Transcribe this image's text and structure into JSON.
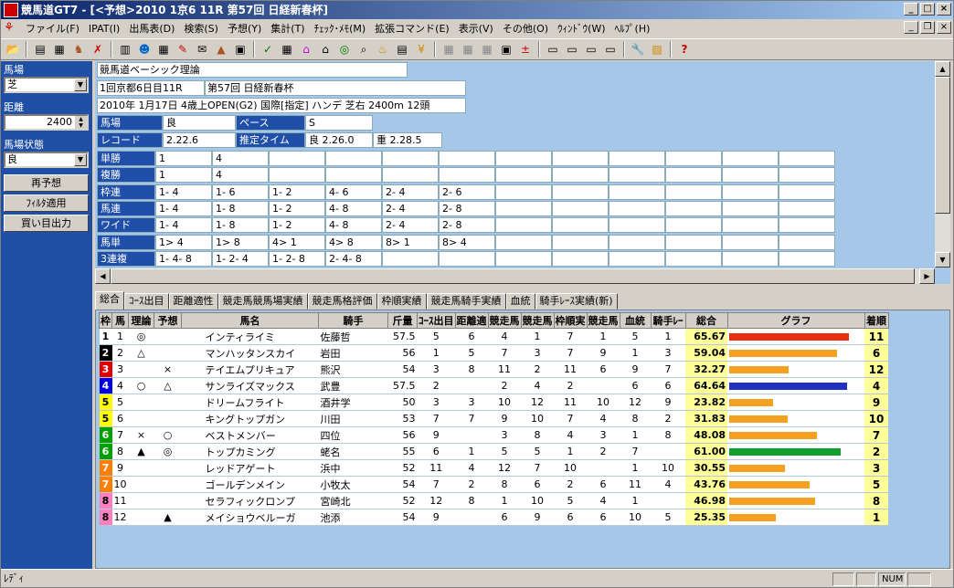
{
  "title": "競馬道GT7 - [<予想>2010 1京6 11R 第57回 日経新春杯]",
  "menu": [
    "ファイル(F)",
    "IPAT(I)",
    "出馬表(D)",
    "検索(S)",
    "予想(Y)",
    "集計(T)",
    "ﾁｪｯｸ･ﾒﾓ(M)",
    "拡張コマンド(E)",
    "表示(V)",
    "その他(O)",
    "ｳｨﾝﾄﾞｳ(W)",
    "ﾍﾙﾌﾟ(H)"
  ],
  "left": {
    "track_label": "馬場",
    "track_value": "芝",
    "distance_label": "距離",
    "distance_value": "2400",
    "condition_label": "馬場状態",
    "condition_value": "良",
    "btn_repredict": "再予想",
    "btn_filter": "ﾌｨﾙﾀ適用",
    "btn_output": "買い目出力"
  },
  "info": {
    "theory": "競馬道ベーシック理論",
    "race_day": "1回京都6日目11R",
    "race_name": "第57回 日経新春杯",
    "race_detail": "2010年 1月17日  4歳上OPEN(G2) 国際[指定] ハンデ 芝右 2400m 12頭",
    "baba_label": "馬場",
    "baba_value": "良",
    "pace_label": "ペース",
    "pace_value": "S",
    "record_label": "レコード",
    "record_value": "2.22.6",
    "est_label": "推定タイム",
    "est_good": "良 2.26.0",
    "est_heavy": "重 2.28.5"
  },
  "bets": [
    {
      "label": "単勝",
      "vals": [
        "1",
        "4"
      ]
    },
    {
      "label": "複勝",
      "vals": [
        "1",
        "4"
      ]
    },
    {
      "label": "枠連",
      "vals": [
        "1- 4",
        "1- 6",
        "1- 2",
        "4- 6",
        "2- 4",
        "2- 6"
      ]
    },
    {
      "label": "馬連",
      "vals": [
        "1- 4",
        "1- 8",
        "1- 2",
        "4- 8",
        "2- 4",
        "2- 8"
      ]
    },
    {
      "label": "ワイド",
      "vals": [
        "1- 4",
        "1- 8",
        "1- 2",
        "4- 8",
        "2- 4",
        "2- 8"
      ]
    },
    {
      "label": "馬単",
      "vals": [
        "1> 4",
        "1> 8",
        "4> 1",
        "4> 8",
        "8> 1",
        "8> 4"
      ]
    },
    {
      "label": "3連複",
      "vals": [
        "1- 4- 8",
        "1- 2- 4",
        "1- 2- 8",
        "2- 4- 8"
      ]
    }
  ],
  "tabs": [
    "総合",
    "ｺｰｽ出目",
    "距離適性",
    "競走馬競馬場実績",
    "競走馬格評価",
    "枠順実績",
    "競走馬騎手実績",
    "血統",
    "騎手ﾚｰｽ実績(新)"
  ],
  "columns": [
    "枠",
    "馬",
    "理論",
    "予想",
    "馬名",
    "騎手",
    "斤量",
    "ｺｰｽ出目",
    "距離適",
    "競走馬",
    "競走馬",
    "枠順実",
    "競走馬",
    "血統",
    "騎手ﾚｰ",
    "総合",
    "グラフ",
    "着順"
  ],
  "colors": {
    "waku1": "#ffffff",
    "waku2": "#000000",
    "waku3": "#e00000",
    "waku4": "#0000e0",
    "waku5": "#ffff00",
    "waku6": "#00a000",
    "waku7": "#ff8000",
    "waku8": "#ff80c0",
    "bar_red": "#e83010",
    "bar_orange": "#f4a020",
    "bar_blue": "#2030c0",
    "bar_green": "#10a030"
  },
  "rows": [
    {
      "waku": "1",
      "num": "1",
      "riron": "◎",
      "yoso": "",
      "name": "インティライミ",
      "jockey": "佐藤哲",
      "kinryo": "57.5",
      "c1": "5",
      "c2": "6",
      "c3": "4",
      "c4": "1",
      "c5": "7",
      "c6": "1",
      "c7": "5",
      "c8": "1",
      "total": "65.67",
      "score": 65.67,
      "bar": "bar_red",
      "rank": "11"
    },
    {
      "waku": "2",
      "num": "2",
      "riron": "△",
      "yoso": "",
      "name": "マンハッタンスカイ",
      "jockey": "岩田",
      "kinryo": "56",
      "c1": "1",
      "c2": "5",
      "c3": "7",
      "c4": "3",
      "c5": "7",
      "c6": "9",
      "c7": "1",
      "c8": "3",
      "total": "59.04",
      "score": 59.04,
      "bar": "bar_orange",
      "rank": "6"
    },
    {
      "waku": "3",
      "num": "3",
      "riron": "",
      "yoso": "×",
      "name": "テイエムプリキュア",
      "jockey": "熊沢",
      "kinryo": "54",
      "c1": "3",
      "c2": "8",
      "c3": "11",
      "c4": "2",
      "c5": "11",
      "c6": "6",
      "c7": "9",
      "c8": "7",
      "total": "32.27",
      "score": 32.27,
      "bar": "bar_orange",
      "rank": "12"
    },
    {
      "waku": "4",
      "num": "4",
      "riron": "○",
      "yoso": "△",
      "name": "サンライズマックス",
      "jockey": "武豊",
      "kinryo": "57.5",
      "c1": "2",
      "c2": "",
      "c3": "2",
      "c4": "4",
      "c5": "2",
      "c6": "",
      "c7": "6",
      "c8": "6",
      "total": "64.64",
      "score": 64.64,
      "bar": "bar_blue",
      "rank": "4"
    },
    {
      "waku": "5",
      "num": "5",
      "riron": "",
      "yoso": "",
      "name": "ドリームフライト",
      "jockey": "酒井学",
      "kinryo": "50",
      "c1": "3",
      "c2": "3",
      "c3": "10",
      "c4": "12",
      "c5": "11",
      "c6": "10",
      "c7": "12",
      "c8": "9",
      "total": "23.82",
      "score": 23.82,
      "bar": "bar_orange",
      "rank": "9"
    },
    {
      "waku": "5",
      "num": "6",
      "riron": "",
      "yoso": "",
      "name": "キングトップガン",
      "jockey": "川田",
      "kinryo": "53",
      "c1": "7",
      "c2": "7",
      "c3": "9",
      "c4": "10",
      "c5": "7",
      "c6": "4",
      "c7": "8",
      "c8": "2",
      "total": "31.83",
      "score": 31.83,
      "bar": "bar_orange",
      "rank": "10"
    },
    {
      "waku": "6",
      "num": "7",
      "riron": "×",
      "yoso": "○",
      "name": "ベストメンバー",
      "jockey": "四位",
      "kinryo": "56",
      "c1": "9",
      "c2": "",
      "c3": "3",
      "c4": "8",
      "c5": "4",
      "c6": "3",
      "c7": "1",
      "c8": "8",
      "total": "48.08",
      "score": 48.08,
      "bar": "bar_orange",
      "rank": "7"
    },
    {
      "waku": "6",
      "num": "8",
      "riron": "▲",
      "yoso": "◎",
      "name": "トップカミング",
      "jockey": "蛯名",
      "kinryo": "55",
      "c1": "6",
      "c2": "1",
      "c3": "5",
      "c4": "5",
      "c5": "1",
      "c6": "2",
      "c7": "7",
      "c8": "",
      "total": "61.00",
      "score": 61.0,
      "bar": "bar_green",
      "rank": "2"
    },
    {
      "waku": "7",
      "num": "9",
      "riron": "",
      "yoso": "",
      "name": "レッドアゲート",
      "jockey": "浜中",
      "kinryo": "52",
      "c1": "11",
      "c2": "4",
      "c3": "12",
      "c4": "7",
      "c5": "10",
      "c6": "",
      "c7": "1",
      "c8": "10",
      "total": "30.55",
      "score": 30.55,
      "bar": "bar_orange",
      "rank": "3"
    },
    {
      "waku": "7",
      "num": "10",
      "riron": "",
      "yoso": "",
      "name": "ゴールデンメイン",
      "jockey": "小牧太",
      "kinryo": "54",
      "c1": "7",
      "c2": "2",
      "c3": "8",
      "c4": "6",
      "c5": "2",
      "c6": "6",
      "c7": "11",
      "c8": "4",
      "total": "43.76",
      "score": 43.76,
      "bar": "bar_orange",
      "rank": "5"
    },
    {
      "waku": "8",
      "num": "11",
      "riron": "",
      "yoso": "",
      "name": "セラフィックロンプ",
      "jockey": "宮崎北",
      "kinryo": "52",
      "c1": "12",
      "c2": "8",
      "c3": "1",
      "c4": "10",
      "c5": "5",
      "c6": "4",
      "c7": "1",
      "c8": "",
      "total": "46.98",
      "score": 46.98,
      "bar": "bar_orange",
      "rank": "8"
    },
    {
      "waku": "8",
      "num": "12",
      "riron": "",
      "yoso": "▲",
      "name": "メイショウベルーガ",
      "jockey": "池添",
      "kinryo": "54",
      "c1": "9",
      "c2": "",
      "c3": "6",
      "c4": "9",
      "c5": "6",
      "c6": "6",
      "c7": "10",
      "c8": "5",
      "total": "25.35",
      "score": 25.35,
      "bar": "bar_orange",
      "rank": "1"
    }
  ],
  "status": {
    "text": "ﾚﾃﾞｨ",
    "num": "NUM"
  }
}
